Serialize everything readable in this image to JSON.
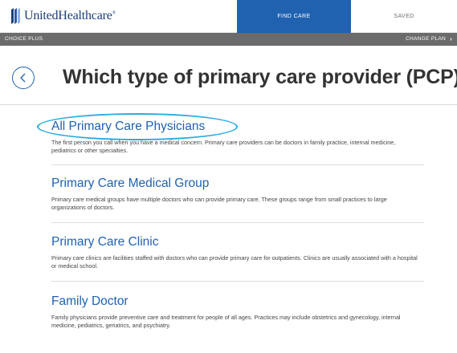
{
  "brand": {
    "name": "UnitedHealthcare",
    "mark": "®",
    "color": "#1d3f77"
  },
  "nav": {
    "find_care": "FIND CARE",
    "saved": "SAVED",
    "active_color": "#2062b0"
  },
  "plan_bar": {
    "plan_name": "CHOICE PLUS",
    "change_plan": "CHANGE PLAN"
  },
  "page": {
    "title": "Which type of primary care provider (PCP)?",
    "back_icon": "chevron-left-icon"
  },
  "options": [
    {
      "title": "All Primary Care Physicians",
      "description": "The first person you call when you have a medical concern. Primary care providers can be doctors in family practice, internal medicine, pediatrics or other specialties.",
      "highlighted": true
    },
    {
      "title": "Primary Care Medical Group",
      "description": "Primary care medical groups have multiple doctors who can provide primary care. These groups range from small practices to large organizations of doctors."
    },
    {
      "title": "Primary Care Clinic",
      "description": "Primary care clinics are facilities staffed with doctors who can provide primary care for outpatients. Clinics are usually associated with a hospital or medical school."
    },
    {
      "title": "Family Doctor",
      "description": "Family physicians provide preventive care and treatment for people of all ages. Practices may include obstetrics and gynecology, internal medicine, pediatrics, geriatrics, and psychiatry."
    }
  ],
  "colors": {
    "link": "#2062b0",
    "highlight_ring": "#29abe2",
    "plan_bar": "#6b6b6b"
  }
}
